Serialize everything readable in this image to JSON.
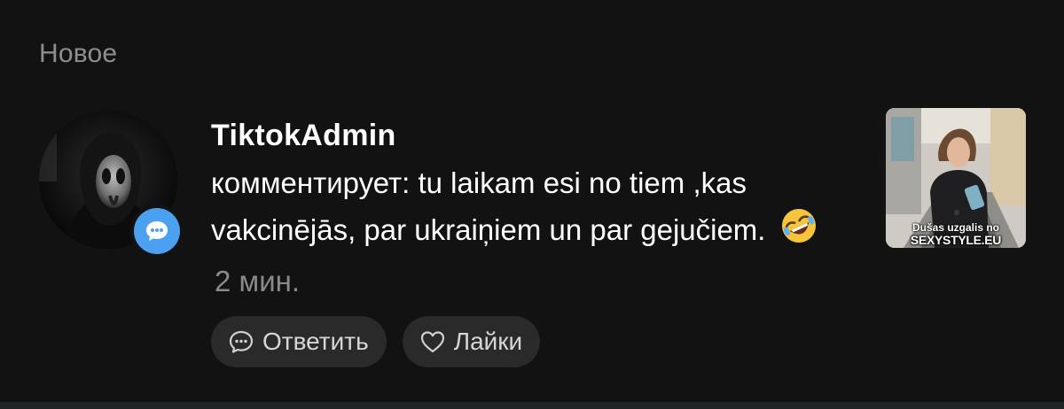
{
  "section": {
    "title": "Новое"
  },
  "notification": {
    "username": "TiktokAdmin",
    "action_prefix": "комментирует: ",
    "comment_text": "tu laikam esi no tiem ,kas vakcinējās, par ukraiņiem un par gejučiem.",
    "emoji": "rolling-on-floor-laughing-emoji",
    "time": "2 мин.",
    "badge_icon": "comment-bubble-icon",
    "badge_color": "#4ba0f0",
    "thumbnail": {
      "caption_line1": "Dušas uzgalis no",
      "caption_line2": "SEXYSTYLE.EU"
    }
  },
  "actions": {
    "reply_label": "Ответить",
    "reply_icon": "comment-bubble-icon",
    "like_label": "Лайки",
    "like_icon": "heart-outline-icon"
  },
  "colors": {
    "background": "#121212",
    "secondary_text": "#8e8e8e",
    "pill_background": "#2a2a2a"
  }
}
